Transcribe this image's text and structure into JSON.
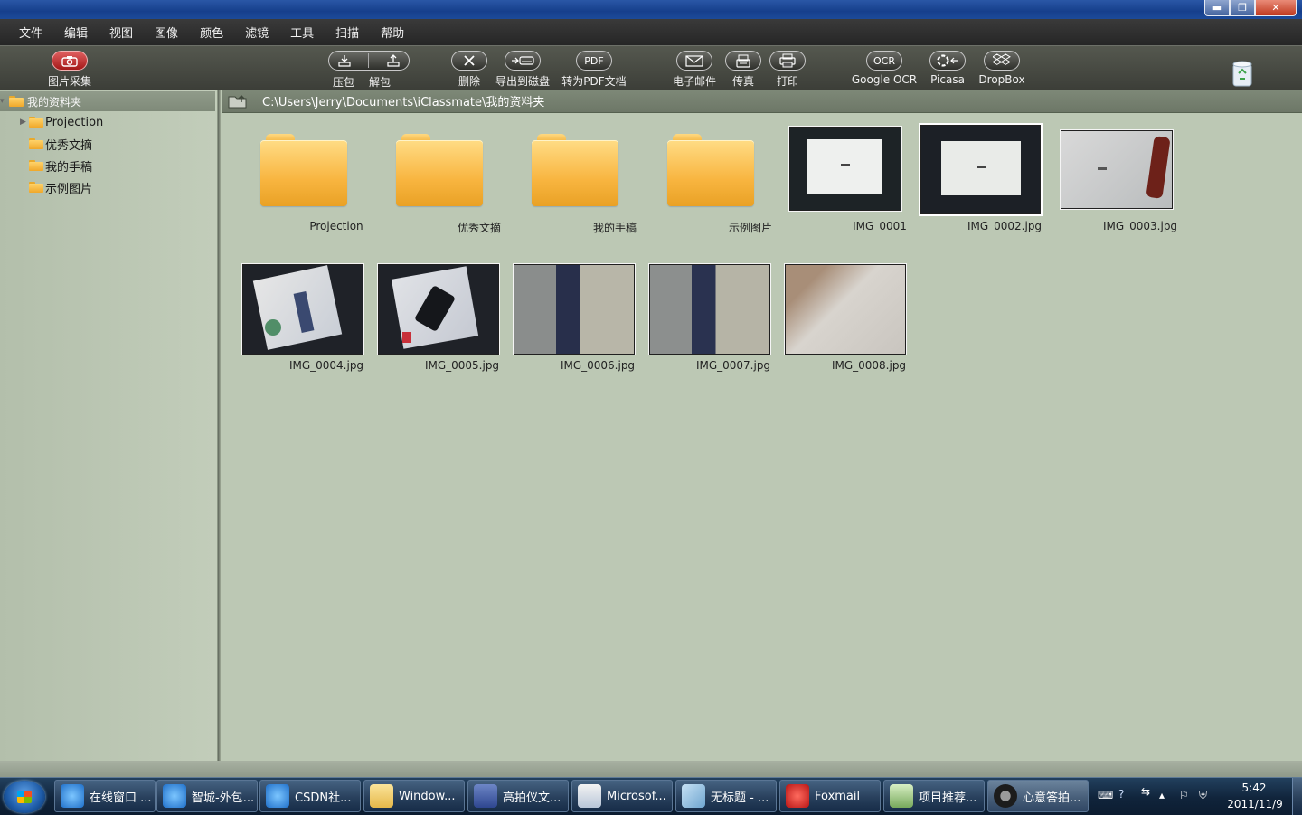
{
  "menu": [
    "文件",
    "编辑",
    "视图",
    "图像",
    "颜色",
    "滤镜",
    "工具",
    "扫描",
    "帮助"
  ],
  "toolbar": {
    "capture": "图片采集",
    "pack": "压包",
    "unpack": "解包",
    "delete": "删除",
    "export_disk": "导出到磁盘",
    "to_pdf": "转为PDF文档",
    "pdf_badge": "PDF",
    "email": "电子邮件",
    "fax": "传真",
    "print": "打印",
    "google_ocr": "Google OCR",
    "ocr_badge": "OCR",
    "picasa": "Picasa",
    "dropbox": "DropBox"
  },
  "tree": {
    "root": "我的资料夹",
    "items": [
      "Projection",
      "优秀文摘",
      "我的手稿",
      "示例图片"
    ]
  },
  "path": "C:\\Users\\Jerry\\Documents\\iClassmate\\我的资料夹",
  "files": {
    "folders": [
      "Projection",
      "优秀文摘",
      "我的手稿",
      "示例图片"
    ],
    "images": [
      "IMG_0001",
      "IMG_0002.jpg",
      "IMG_0003.jpg",
      "IMG_0004.jpg",
      "IMG_0005.jpg",
      "IMG_0006.jpg",
      "IMG_0007.jpg",
      "IMG_0008.jpg"
    ],
    "selected": "IMG_0002.jpg"
  },
  "taskbar": {
    "tasks": [
      "在线窗口 ...",
      "智城-外包...",
      "CSDN社...",
      "Window...",
      "高拍仪文...",
      "Microsof...",
      "无标题 - ...",
      "Foxmail",
      "项目推荐...",
      "心意答拍..."
    ],
    "time": "5:42",
    "date": "2011/11/9"
  },
  "colors": {
    "content_bg": "#bcc8b4",
    "folder": "#f8b540",
    "taskbar": "#10243b"
  }
}
